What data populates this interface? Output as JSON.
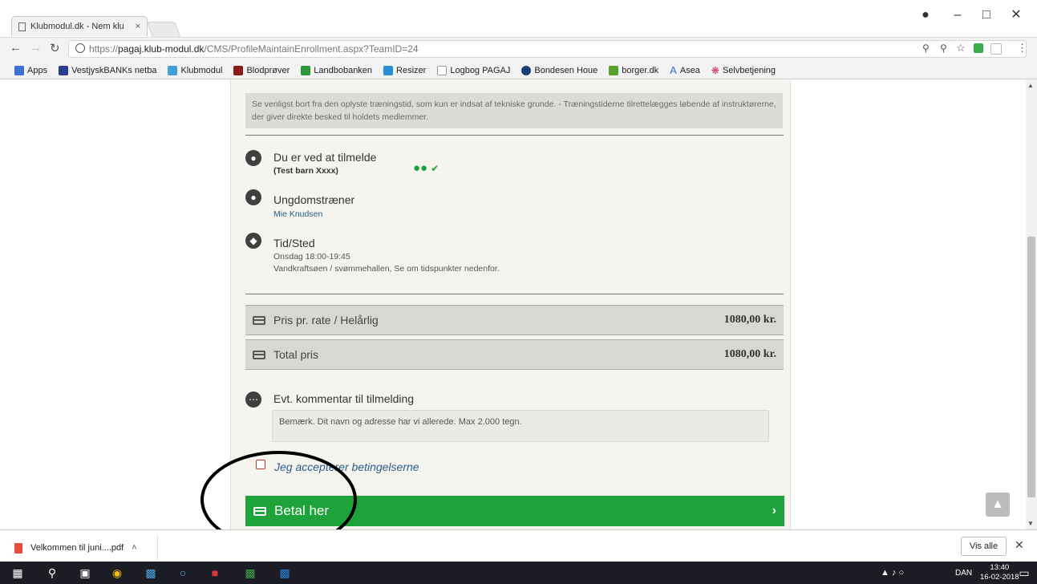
{
  "browser": {
    "tab_title": "Klubmodul.dk - Nem klu",
    "tab_close": "×",
    "url_prefix": "https://",
    "url_host": "pagaj.klub-modul.dk",
    "url_path": "/CMS/ProfileMaintainEnrollment.aspx?TeamID=24",
    "bookmarks": [
      {
        "label": "Apps",
        "color": "#3b6fd1"
      },
      {
        "label": "VestjyskBANKs netba",
        "color": "#2c3e8c"
      },
      {
        "label": "Klubmodul",
        "color": "#3fa0d8"
      },
      {
        "label": "Blodprøver",
        "color": "#8b1a1a"
      },
      {
        "label": "Landbobanken",
        "color": "#2c9a3a"
      },
      {
        "label": "Resizer",
        "color": "#2a8fd6"
      },
      {
        "label": "Logbog PAGAJ",
        "color": "#999999"
      },
      {
        "label": "Bondesen Houe",
        "color": "#1f3c74"
      },
      {
        "label": "borger.dk",
        "color": "#5aa02c"
      },
      {
        "label": "Asea",
        "color": "#3a6bd1"
      },
      {
        "label": "Selvbetjening",
        "color": "#d12a6a"
      }
    ]
  },
  "page": {
    "notice": "Se venligst bort fra den oplyste træningstid, som kun er indsat af tekniske grunde. - Træningstiderne tilrettelægges løbende af instruktørerne, der giver direkte besked til holdets medlemmer.",
    "enroll_title": "Du er ved at tilmelde",
    "enroll_name": "(Test barn Xxxx)",
    "trainer_title": "Ungdomstræner",
    "trainer_name": "Mie Knudsen",
    "place_title": "Tid/Sted",
    "place_time": "Onsdag 18:00-19:45",
    "place_location": "Vandkraftsøen / svømmehallen, Se om tidspunkter nedenfor.",
    "price_label": "Pris pr. rate / Helårlig",
    "price_amount": "1080,00 kr.",
    "total_label": "Total pris",
    "total_amount": "1080,00 kr.",
    "comment_title": "Evt. kommentar til tilmelding",
    "comment_placeholder": "Bemærk. Dit navn og adresse har vi allerede. Max 2.000 tegn.",
    "accept_label": "Jeg accepterer betingelserne",
    "pay_label": "Betal her",
    "accent_green": "#1ea23a"
  },
  "downloads": {
    "file": "Velkommen til juni....pdf",
    "show_all": "Vis alle"
  },
  "taskbar": {
    "lang": "DAN",
    "time": "13:40",
    "date": "16-02-2018"
  }
}
